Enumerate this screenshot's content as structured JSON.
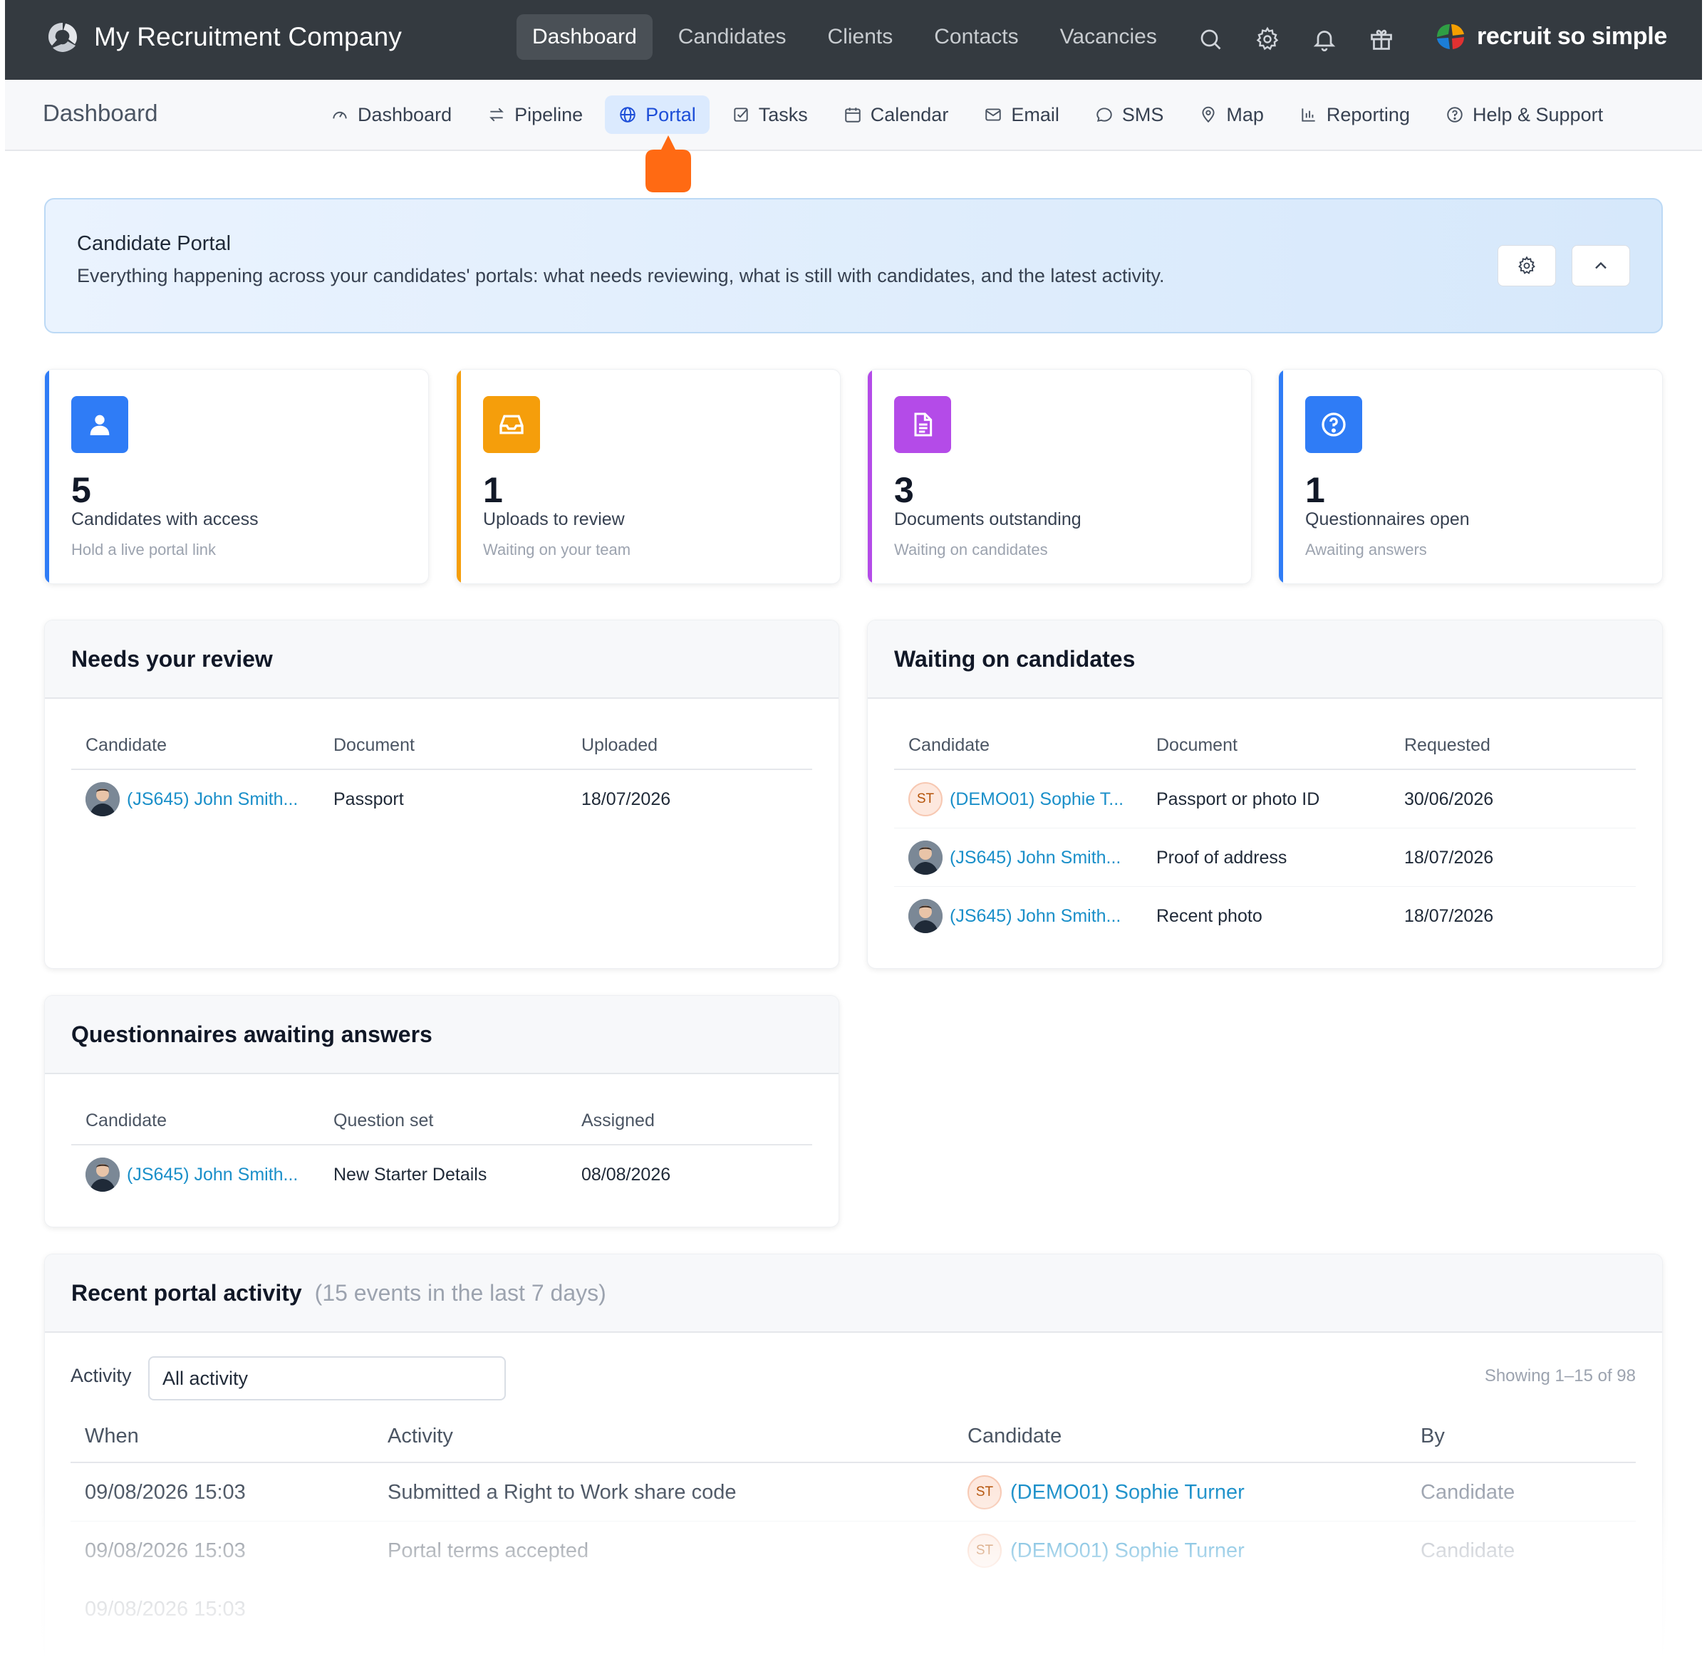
{
  "app": {
    "company_name": "My Recruitment Company",
    "brand_name": "recruit so simple"
  },
  "topnav": {
    "items": [
      {
        "label": "Dashboard",
        "active": true
      },
      {
        "label": "Candidates"
      },
      {
        "label": "Clients"
      },
      {
        "label": "Contacts"
      },
      {
        "label": "Vacancies"
      }
    ],
    "icons": [
      "search-icon",
      "gear-icon",
      "bell-icon",
      "gift-icon"
    ]
  },
  "subbar": {
    "title": "Dashboard",
    "items": [
      {
        "label": "Dashboard",
        "icon": "gauge-icon"
      },
      {
        "label": "Pipeline",
        "icon": "swap-icon"
      },
      {
        "label": "Portal",
        "icon": "globe-icon",
        "active": true
      },
      {
        "label": "Tasks",
        "icon": "checkbox-icon"
      },
      {
        "label": "Calendar",
        "icon": "calendar-icon"
      },
      {
        "label": "Email",
        "icon": "mail-icon"
      },
      {
        "label": "SMS",
        "icon": "chat-icon"
      },
      {
        "label": "Map",
        "icon": "map-pin-icon"
      },
      {
        "label": "Reporting",
        "icon": "bar-chart-icon"
      },
      {
        "label": "Help & Support",
        "icon": "help-icon"
      }
    ]
  },
  "banner": {
    "title": "Candidate Portal",
    "description": "Everything happening across your candidates' portals: what needs reviewing, what is still with candidates, and the latest activity."
  },
  "stats": [
    {
      "value": "5",
      "label": "Candidates with access",
      "sub": "Hold a live portal link",
      "color": "#2f7cf6",
      "icon": "user-icon"
    },
    {
      "value": "1",
      "label": "Uploads to review",
      "sub": "Waiting on your team",
      "color": "#f59e0b",
      "icon": "inbox-icon"
    },
    {
      "value": "3",
      "label": "Documents outstanding",
      "sub": "Waiting on candidates",
      "color": "#b44be8",
      "icon": "document-icon"
    },
    {
      "value": "1",
      "label": "Questionnaires open",
      "sub": "Awaiting answers",
      "color": "#2f7cf6",
      "icon": "question-icon"
    }
  ],
  "review": {
    "title": "Needs your review",
    "columns": [
      "Candidate",
      "Document",
      "Uploaded"
    ],
    "rows": [
      {
        "candidate": "(JS645) John Smith...",
        "document": "Passport",
        "date": "18/07/2026"
      }
    ]
  },
  "waiting": {
    "title": "Waiting on candidates",
    "columns": [
      "Candidate",
      "Document",
      "Requested"
    ],
    "rows": [
      {
        "candidate": "(DEMO01) Sophie T...",
        "initials": "ST",
        "document": "Passport or photo ID",
        "date": "30/06/2026"
      },
      {
        "candidate": "(JS645) John Smith...",
        "document": "Proof of address",
        "date": "18/07/2026"
      },
      {
        "candidate": "(JS645) John Smith...",
        "document": "Recent photo",
        "date": "18/07/2026"
      }
    ]
  },
  "questionnaires": {
    "title": "Questionnaires awaiting answers",
    "columns": [
      "Candidate",
      "Question set",
      "Assigned"
    ],
    "rows": [
      {
        "candidate": "(JS645) John Smith...",
        "set": "New Starter Details",
        "date": "08/08/2026"
      }
    ]
  },
  "activity": {
    "title": "Recent portal activity",
    "note": "(15 events in the last 7 days)",
    "filter_label": "Activity",
    "filter_value": "All activity",
    "showing": "Showing 1–15 of 98",
    "columns": [
      "When",
      "Activity",
      "Candidate",
      "By"
    ],
    "rows": [
      {
        "when": "09/08/2026 15:03",
        "activity": "Submitted a Right to Work share code",
        "candidate": "(DEMO01) Sophie Turner",
        "initials": "ST",
        "by": "Candidate"
      },
      {
        "when": "09/08/2026 15:03",
        "activity": "Portal terms accepted",
        "candidate": "(DEMO01) Sophie Turner",
        "initials": "ST",
        "by": "Candidate"
      },
      {
        "when": "09/08/2026 15:03",
        "activity": "",
        "candidate": "",
        "initials": "",
        "by": ""
      }
    ]
  }
}
